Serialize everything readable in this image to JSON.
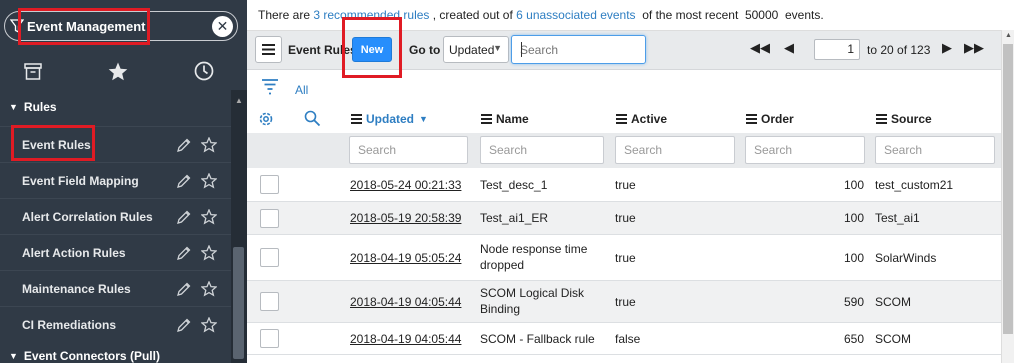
{
  "navigator": {
    "filter_value": "Event Management",
    "clear_label": "✕",
    "tabs": [
      {
        "name": "all-applications",
        "icon": "archive-icon"
      },
      {
        "name": "favorites",
        "icon": "star-icon"
      },
      {
        "name": "history",
        "icon": "clock-icon"
      }
    ],
    "section_label": "Rules",
    "items": [
      {
        "label": "Event Rules"
      },
      {
        "label": "Event Field Mapping"
      },
      {
        "label": "Alert Correlation Rules"
      },
      {
        "label": "Alert Action Rules"
      },
      {
        "label": "Maintenance Rules"
      },
      {
        "label": "CI Remediations"
      }
    ],
    "footer_label": "Event Connectors (Pull)"
  },
  "info_bar": {
    "prefix": "There are ",
    "rec_link": "3 recommended rules",
    "middle": " , created out of ",
    "unassoc_link": "6 unassociated events",
    "suffix": "  of the most recent  50000  events."
  },
  "toolbar": {
    "list_title": "Event Rules",
    "new_label": "New",
    "goto_label": "Go to",
    "goto_field": "Updated",
    "search_placeholder": "Search",
    "page_value": "1",
    "page_range": "to 20 of 123"
  },
  "filter": {
    "all_label": "All"
  },
  "columns": [
    {
      "label": "Updated",
      "sorted": true
    },
    {
      "label": "Name"
    },
    {
      "label": "Active"
    },
    {
      "label": "Order"
    },
    {
      "label": "Source"
    }
  ],
  "column_search_placeholder": "Search",
  "rows": [
    {
      "updated": "2018-05-24 00:21:33",
      "name": "Test_desc_1",
      "active": "true",
      "order": "100",
      "source": "test_custom21"
    },
    {
      "updated": "2018-05-19 20:58:39",
      "name": "Test_ai1_ER",
      "active": "true",
      "order": "100",
      "source": "Test_ai1"
    },
    {
      "updated": "2018-04-19 05:05:24",
      "name": "Node response time dropped",
      "active": "true",
      "order": "100",
      "source": "SolarWinds"
    },
    {
      "updated": "2018-04-19 04:05:44",
      "name": "SCOM Logical Disk Binding",
      "active": "true",
      "order": "590",
      "source": "SCOM"
    },
    {
      "updated": "2018-04-19 04:05:44",
      "name": "SCOM - Fallback rule",
      "active": "false",
      "order": "650",
      "source": "SCOM"
    }
  ],
  "colors": {
    "nav_bg": "#303a46",
    "accent_blue": "#278efc",
    "link_blue": "#2e7ec2",
    "highlight_red": "#e01b24"
  }
}
